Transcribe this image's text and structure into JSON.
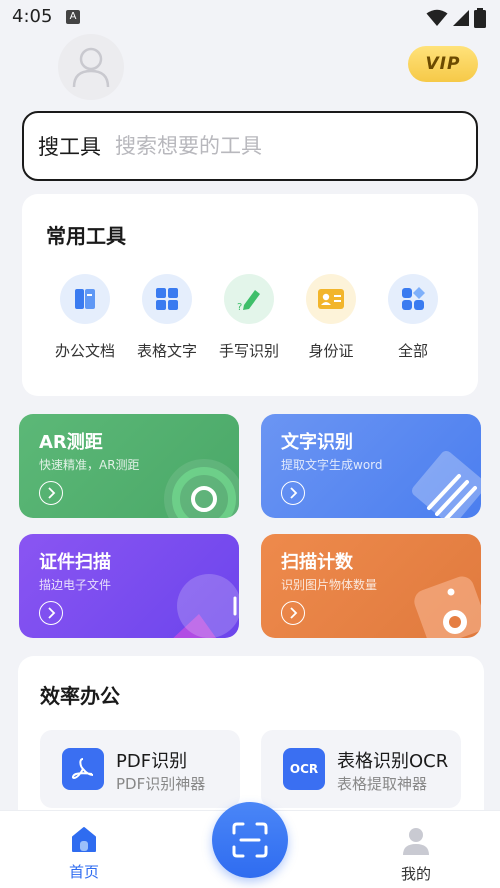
{
  "status_bar": {
    "time": "4:05",
    "notification": "A"
  },
  "header": {
    "vip_label": "VIP"
  },
  "search": {
    "label": "搜工具",
    "placeholder": "搜索想要的工具"
  },
  "common_tools": {
    "title": "常用工具",
    "items": [
      {
        "label": "办公文档",
        "icon": "document-icon",
        "bg": "#e5eefc",
        "color": "#3a7bf0"
      },
      {
        "label": "表格文字",
        "icon": "grid-icon",
        "bg": "#e5eefc",
        "color": "#3a7bf0"
      },
      {
        "label": "手写识别",
        "icon": "pen-icon",
        "bg": "#e3f5ea",
        "color": "#3fbf6a"
      },
      {
        "label": "身份证",
        "icon": "id-card-icon",
        "bg": "#fdf3d9",
        "color": "#f2b52b"
      },
      {
        "label": "全部",
        "icon": "apps-icon",
        "bg": "#e5eefc",
        "color": "#3a7bf0"
      }
    ]
  },
  "features": [
    {
      "title": "AR测距",
      "subtitle": "快速精准，AR测距",
      "bg": "#5bb474"
    },
    {
      "title": "文字识别",
      "subtitle": "提取文字生成word",
      "bg": "#5a8af0"
    },
    {
      "title": "证件扫描",
      "subtitle": "描边电子文件",
      "bg": "#7b4ff0"
    },
    {
      "title": "扫描计数",
      "subtitle": "识别图片物体数量",
      "bg": "#ea8346"
    }
  ],
  "efficiency": {
    "title": "效率办公",
    "items": [
      {
        "name": "PDF识别",
        "desc": "PDF识别神器",
        "icon": "pdf-icon"
      },
      {
        "name": "表格识别OCR",
        "desc": "表格提取神器",
        "icon": "ocr-icon",
        "icon_text": "OCR"
      }
    ]
  },
  "bottom_nav": {
    "home_label": "首页",
    "mine_label": "我的",
    "active_color": "#2f6cf0"
  }
}
